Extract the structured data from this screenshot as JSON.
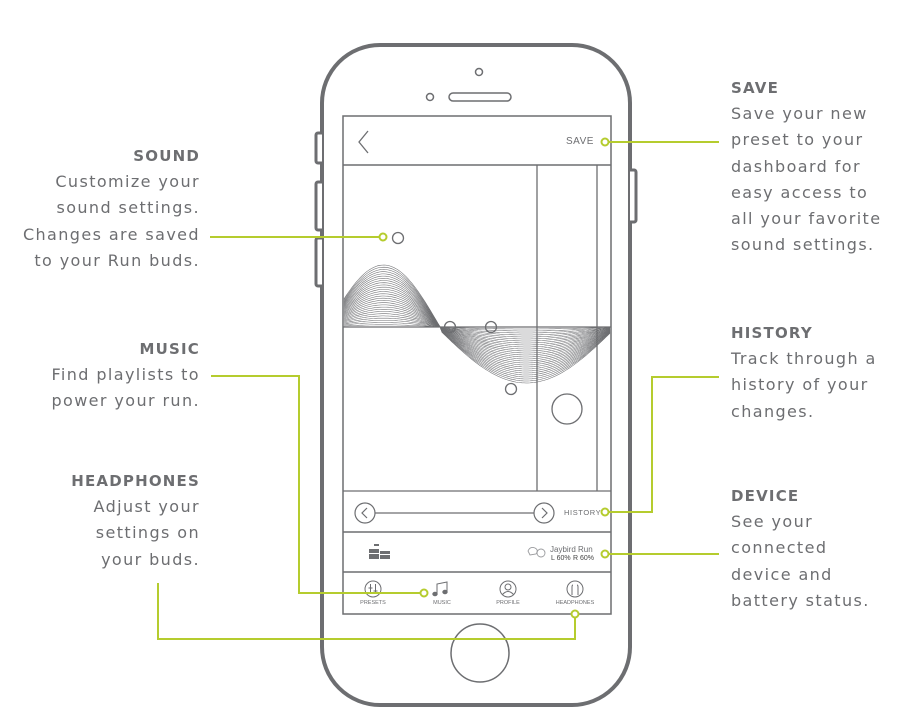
{
  "accent_color": "#b5cc2e",
  "frame_color": "#6d6e71",
  "phone": {
    "header": {
      "back_icon": "chevron-left-icon",
      "save_label": "SAVE"
    },
    "history_bar": {
      "prev_icon": "chevron-left-circle-icon",
      "next_icon": "chevron-right-circle-icon",
      "label": "HISTORY"
    },
    "device_bar": {
      "eq_icon": "equalizer-bars-icon",
      "buds_icon": "earbuds-icon",
      "device_name": "Jaybird Run",
      "battery_left": "L 60%",
      "battery_right": "R 60%"
    },
    "tabs": [
      {
        "label": "PRESETS",
        "icon": "sliders-icon"
      },
      {
        "label": "MUSIC",
        "icon": "music-note-icon"
      },
      {
        "label": "PROFILE",
        "icon": "user-icon"
      },
      {
        "label": "HEADPHONES",
        "icon": "headphones-icon"
      }
    ]
  },
  "callouts": {
    "sound": {
      "title": "SOUND",
      "desc": "Customize your\nsound settings.\nChanges are saved\nto your Run buds."
    },
    "music": {
      "title": "MUSIC",
      "desc": "Find playlists to\npower your run."
    },
    "headphones": {
      "title": "HEADPHONES",
      "desc": "Adjust your\nsettings on\nyour buds."
    },
    "save": {
      "title": "SAVE",
      "desc": "Save your new\npreset to your\ndashboard for\neasy access to\nall your favorite\nsound settings."
    },
    "history": {
      "title": "HISTORY",
      "desc": "Track through a\nhistory of your\nchanges."
    },
    "device": {
      "title": "DEVICE",
      "desc": "See your\nconnected\ndevice and\nbattery status."
    }
  }
}
